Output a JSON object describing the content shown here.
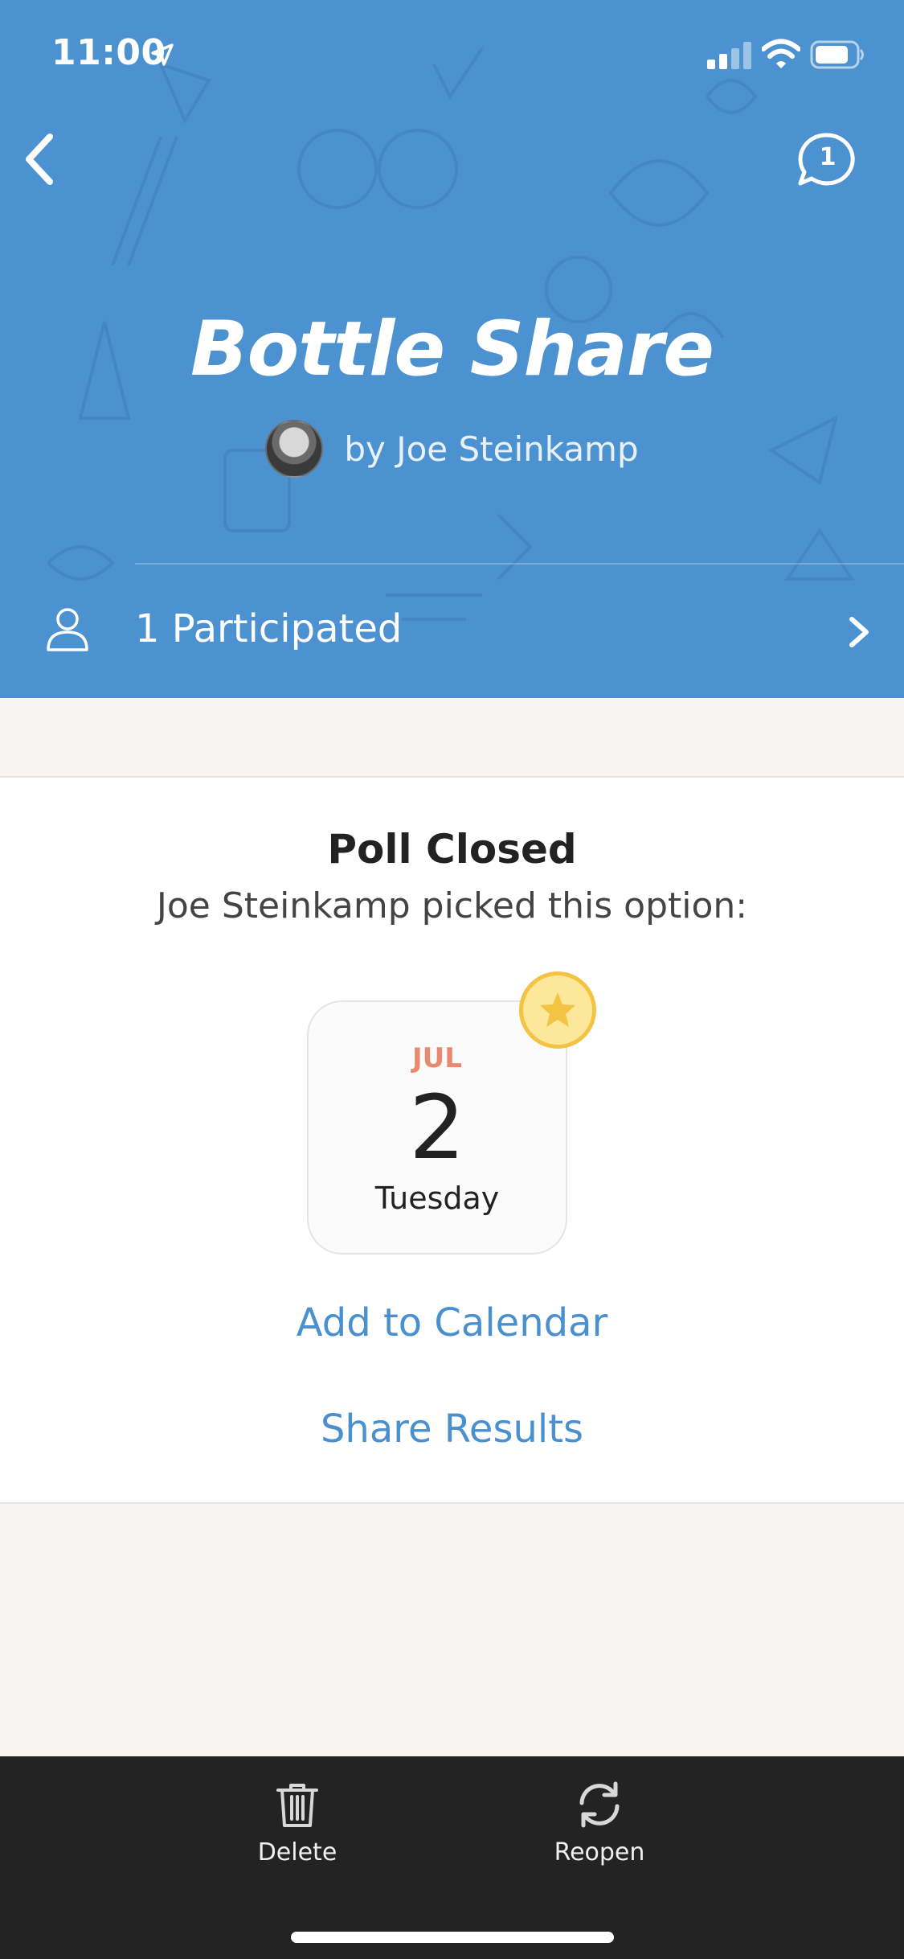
{
  "status_bar": {
    "time": "11:00"
  },
  "header": {
    "title": "Bottle Share",
    "author": "by Joe Steinkamp",
    "comment_count": "1",
    "participants_label": "1 Participated"
  },
  "result": {
    "heading": "Poll Closed",
    "subheading": "Joe Steinkamp picked this option:",
    "date": {
      "month": "JUL",
      "day": "2",
      "weekday": "Tuesday"
    },
    "add_to_calendar": "Add to Calendar",
    "share_results": "Share Results"
  },
  "toolbar": {
    "delete_label": "Delete",
    "reopen_label": "Reopen"
  },
  "colors": {
    "header_blue": "#4d92d0",
    "link_blue": "#4a90cf",
    "month_orange": "#e98a6f",
    "star_yellow": "#f3c343",
    "toolbar_dark": "#232323"
  }
}
